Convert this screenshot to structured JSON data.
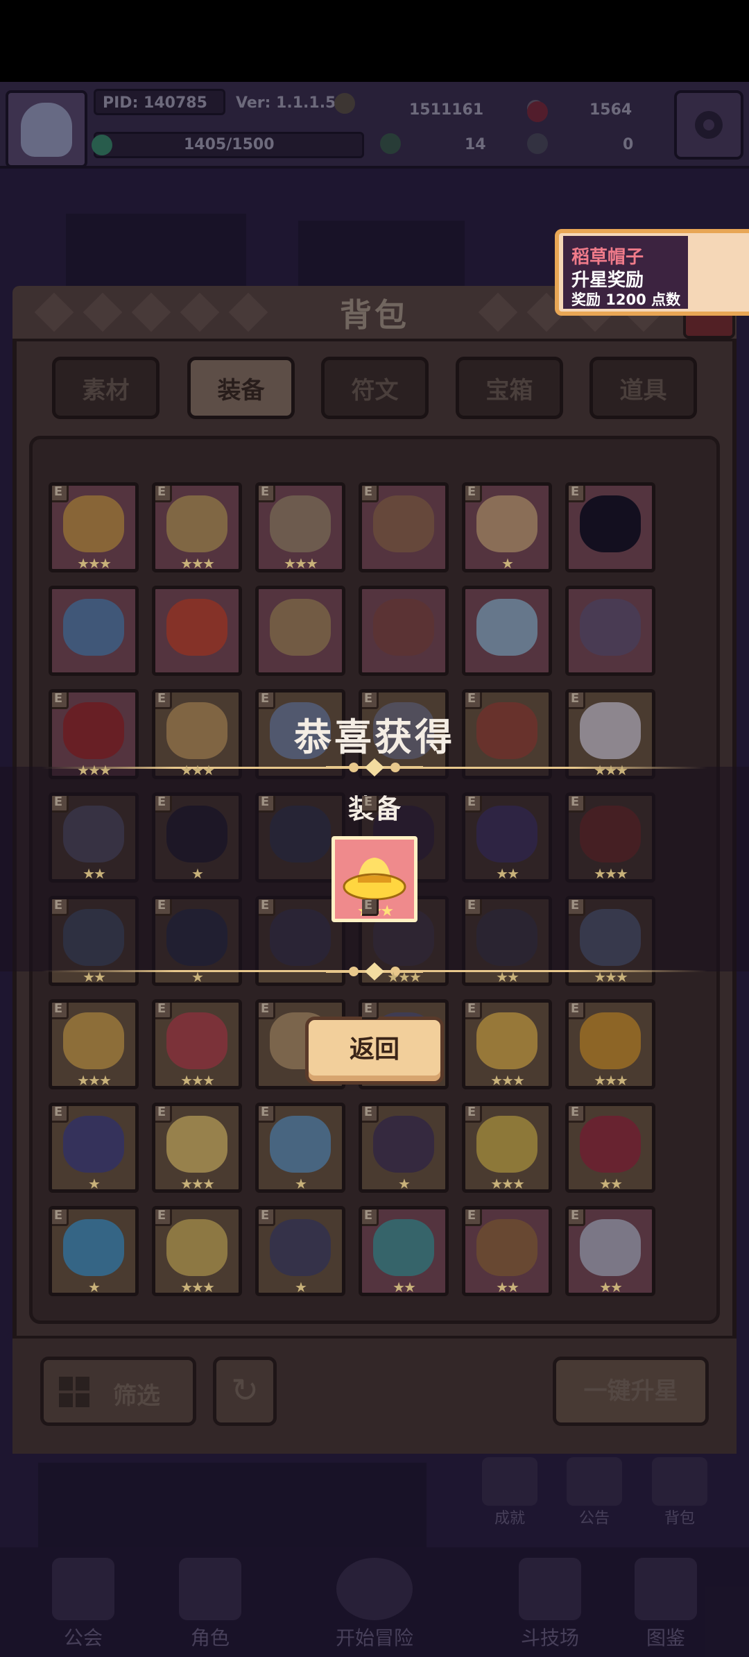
{
  "hud": {
    "pid": "PID: 140785",
    "version": "Ver: 1.1.1.5",
    "exp": "1405/1500",
    "gold": "1511161",
    "gems": "1564",
    "stat_a": "14",
    "stat_b": "0"
  },
  "panel": {
    "title": "背包",
    "tabs": [
      "素材",
      "装备",
      "符文",
      "宝箱",
      "道具"
    ],
    "active_tab": "装备",
    "filter_label": "筛选",
    "upgrade_all_label": "一键升星"
  },
  "items": [
    {
      "bg": "pink",
      "color": "#d6a24a",
      "stars": "★★★",
      "e": "E"
    },
    {
      "bg": "pink",
      "color": "#c9a460",
      "stars": "★★★",
      "e": "E"
    },
    {
      "bg": "pink",
      "color": "#a89070",
      "stars": "★★★",
      "e": "E"
    },
    {
      "bg": "pink",
      "color": "#9c7050",
      "stars": "",
      "e": "E"
    },
    {
      "bg": "pink",
      "color": "#d9b080",
      "stars": "★",
      "e": "E"
    },
    {
      "bg": "pink",
      "color": "#101020",
      "stars": "",
      "e": "E"
    },
    {
      "bg": "pink",
      "color": "#5b8ab8",
      "stars": "",
      "e": ""
    },
    {
      "bg": "pink",
      "color": "#d04a30",
      "stars": "",
      "e": ""
    },
    {
      "bg": "pink",
      "color": "#b09060",
      "stars": "",
      "e": ""
    },
    {
      "bg": "pink",
      "color": "#8a4c44",
      "stars": "",
      "e": ""
    },
    {
      "bg": "pink",
      "color": "#9cc0d8",
      "stars": "",
      "e": ""
    },
    {
      "bg": "pink",
      "color": "#6a5a7a",
      "stars": "",
      "e": ""
    },
    {
      "bg": "pink",
      "color": "#a02a2a",
      "stars": "★★★",
      "e": "E"
    },
    {
      "bg": "gold",
      "color": "#c9a060",
      "stars": "★★★",
      "e": "E"
    },
    {
      "bg": "gold",
      "color": "#7a8aa8",
      "stars": "",
      "e": "E"
    },
    {
      "bg": "gold",
      "color": "#7a7a8a",
      "stars": "",
      "e": "E"
    },
    {
      "bg": "gold",
      "color": "#a04a3a",
      "stars": "",
      "e": "E"
    },
    {
      "bg": "gold",
      "color": "#e0d8e0",
      "stars": "★★★",
      "e": "E"
    },
    {
      "bg": "gold",
      "color": "#8a90b0",
      "stars": "★★",
      "e": "E"
    },
    {
      "bg": "gold",
      "color": "#2a2a44",
      "stars": "★",
      "e": "E"
    },
    {
      "bg": "gold",
      "color": "#4a5a7a",
      "stars": "",
      "e": "E"
    },
    {
      "bg": "gold",
      "color": "#4a3a5a",
      "stars": "",
      "e": "E"
    },
    {
      "bg": "gold",
      "color": "#6a5ab0",
      "stars": "★★",
      "e": "E"
    },
    {
      "bg": "gold",
      "color": "#c04a3a",
      "stars": "★★★",
      "e": "E"
    },
    {
      "bg": "gold",
      "color": "#6a8aa8",
      "stars": "★★",
      "e": "E"
    },
    {
      "bg": "gold",
      "color": "#3a4a6a",
      "stars": "★",
      "e": "E"
    },
    {
      "bg": "gold",
      "color": "#5a5a7a",
      "stars": "",
      "e": "E"
    },
    {
      "bg": "gold",
      "color": "#6a6070",
      "stars": "★★★",
      "e": "E"
    },
    {
      "bg": "gold",
      "color": "#5a5a6a",
      "stars": "★★",
      "e": "E"
    },
    {
      "bg": "gold",
      "color": "#8aa8d0",
      "stars": "★★★",
      "e": "E"
    },
    {
      "bg": "gold",
      "color": "#e0b050",
      "stars": "★★★",
      "e": "E"
    },
    {
      "bg": "gold",
      "color": "#c04a50",
      "stars": "★★★",
      "e": "E"
    },
    {
      "bg": "gold",
      "color": "#c0a070",
      "stars": "",
      "e": "E"
    },
    {
      "bg": "gold",
      "color": "#5a5a7a",
      "stars": "",
      "e": "E"
    },
    {
      "bg": "gold",
      "color": "#f0c050",
      "stars": "★★★",
      "e": "E"
    },
    {
      "bg": "gold",
      "color": "#e0a030",
      "stars": "★★★",
      "e": "E"
    },
    {
      "bg": "gold",
      "color": "#4a4a8a",
      "stars": "★",
      "e": "E"
    },
    {
      "bg": "gold",
      "color": "#f0d070",
      "stars": "★★★",
      "e": "E"
    },
    {
      "bg": "gold",
      "color": "#6aa0c8",
      "stars": "★",
      "e": "E"
    },
    {
      "bg": "gold",
      "color": "#4a3a5a",
      "stars": "★",
      "e": "E"
    },
    {
      "bg": "gold",
      "color": "#e0c050",
      "stars": "★★★",
      "e": "E"
    },
    {
      "bg": "gold",
      "color": "#a03040",
      "stars": "★★",
      "e": "E"
    },
    {
      "bg": "gold",
      "color": "#4aa0d0",
      "stars": "★",
      "e": "E"
    },
    {
      "bg": "gold",
      "color": "#e0c060",
      "stars": "★★★",
      "e": "E"
    },
    {
      "bg": "gold",
      "color": "#4a4a6a",
      "stars": "★",
      "e": "E"
    },
    {
      "bg": "pink",
      "color": "#4aa0a0",
      "stars": "★★",
      "e": "E"
    },
    {
      "bg": "pink",
      "color": "#a07040",
      "stars": "★★",
      "e": "E"
    },
    {
      "bg": "pink",
      "color": "#c0c0d0",
      "stars": "★★",
      "e": "E"
    }
  ],
  "modal": {
    "title": "恭喜获得",
    "category": "装备",
    "reward_stars": "★★★",
    "return_label": "返回"
  },
  "toast": {
    "item_name": "稻草帽子",
    "line2": "升星奖励",
    "line3": "奖励 1200 点数"
  },
  "nav": [
    "公会",
    "角色",
    "开始冒险",
    "斗技场",
    "图鉴"
  ],
  "side": [
    "成就",
    "公告",
    "背包"
  ]
}
